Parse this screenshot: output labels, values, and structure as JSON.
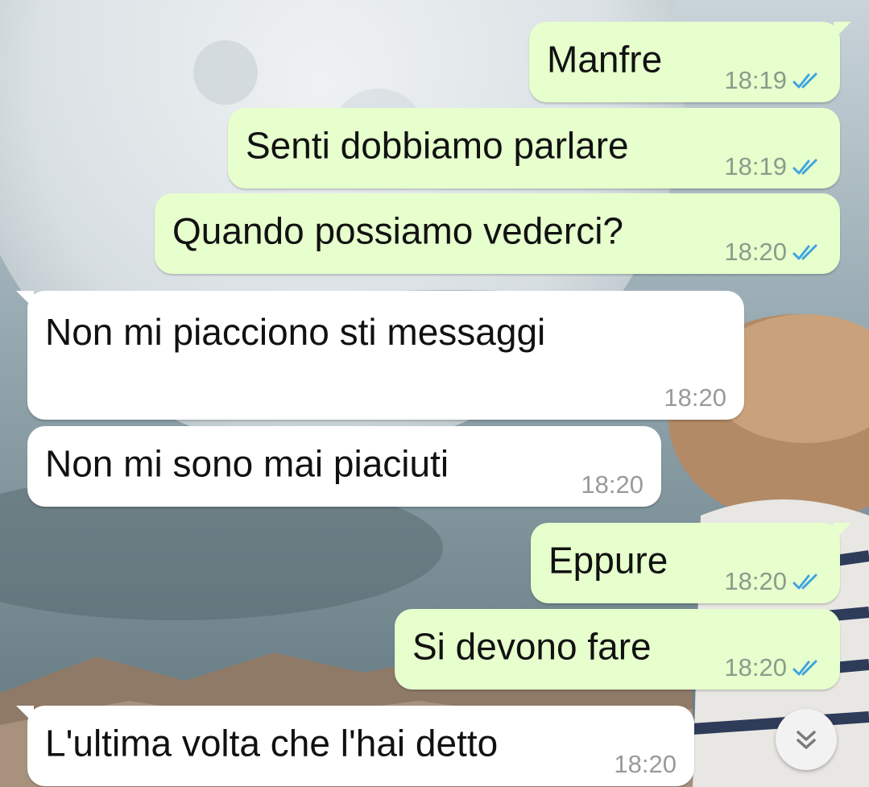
{
  "colors": {
    "outgoing_bubble": "#e6ffcd",
    "incoming_bubble": "#ffffff",
    "read_ticks": "#3fa3e0"
  },
  "messages": [
    {
      "direction": "out",
      "text": "Manfre",
      "time": "18:19",
      "status": "read"
    },
    {
      "direction": "out",
      "text": "Senti dobbiamo parlare",
      "time": "18:19",
      "status": "read"
    },
    {
      "direction": "out",
      "text": "Quando possiamo vederci?",
      "time": "18:20",
      "status": "read"
    },
    {
      "direction": "in",
      "text": "Non mi piacciono sti messaggi",
      "time": "18:20"
    },
    {
      "direction": "in",
      "text": "Non mi sono mai piaciuti",
      "time": "18:20"
    },
    {
      "direction": "out",
      "text": "Eppure",
      "time": "18:20",
      "status": "read"
    },
    {
      "direction": "out",
      "text": "Si devono fare",
      "time": "18:20",
      "status": "read"
    },
    {
      "direction": "in",
      "text": "L'ultima volta che l'hai detto",
      "time": "18:20"
    }
  ],
  "scroll_button": {
    "icon": "double-chevron-down-icon"
  }
}
